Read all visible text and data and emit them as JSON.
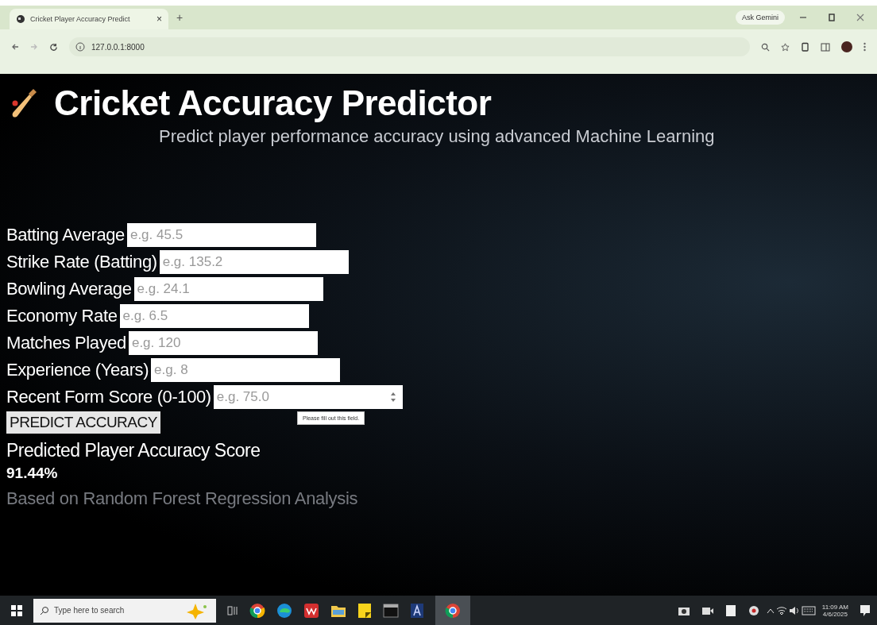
{
  "browser": {
    "tab_title": "Cricket Player Accuracy Predict",
    "close": "×",
    "new_tab": "+",
    "ask_gemini": "Ask Gemini",
    "url": "127.0.0.1:8000"
  },
  "page": {
    "title": "Cricket Accuracy Predictor",
    "subtitle": "Predict player performance accuracy using advanced Machine Learning",
    "fields": [
      {
        "label": "Batting Average",
        "placeholder": "e.g. 45.5",
        "kind": "text"
      },
      {
        "label": "Strike Rate (Batting)",
        "placeholder": "e.g. 135.2",
        "kind": "text"
      },
      {
        "label": "Bowling Average",
        "placeholder": "e.g. 24.1",
        "kind": "text"
      },
      {
        "label": "Economy Rate",
        "placeholder": "e.g. 6.5",
        "kind": "text"
      },
      {
        "label": "Matches Played",
        "placeholder": "e.g. 120",
        "kind": "text"
      },
      {
        "label": "Experience (Years)",
        "placeholder": "e.g. 8",
        "kind": "text"
      },
      {
        "label": "Recent Form Score (0-100)",
        "placeholder": "e.g. 75.0",
        "kind": "number"
      }
    ],
    "button": "PREDICT ACCURACY",
    "tooltip": "Please fill out this field.",
    "result": {
      "heading": "Predicted Player Accuracy Score",
      "value": "91.44%",
      "note": "Based on Random Forest Regression Analysis"
    }
  },
  "taskbar": {
    "search_placeholder": "Type here to search",
    "time": "11:09 AM",
    "date": "4/6/2025"
  }
}
